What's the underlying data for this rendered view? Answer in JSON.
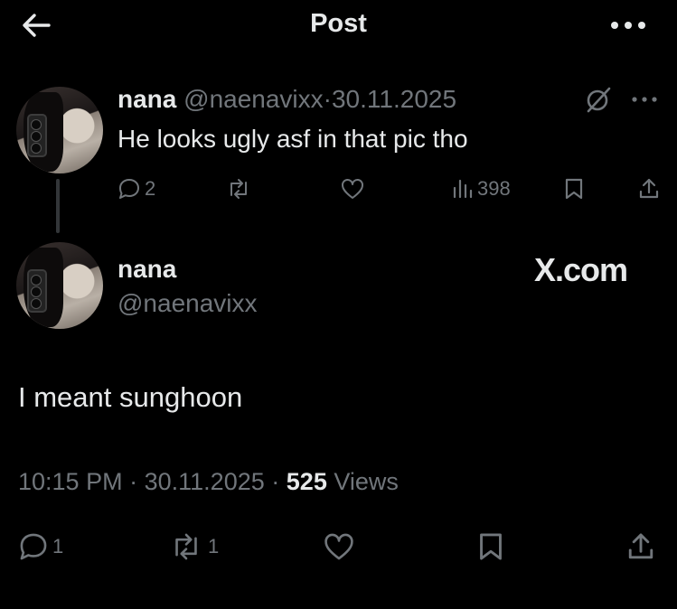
{
  "header": {
    "title": "Post",
    "back_icon": "arrow-left-icon",
    "more_icon": "more-horizontal-icon"
  },
  "reply_tweet": {
    "display_name": "nana",
    "handle": "@naenavixx",
    "separator": "·",
    "date": "30.11.2025",
    "text": "He looks ugly asf in that pic tho",
    "actions": {
      "replies": "2",
      "views": "398"
    }
  },
  "main_tweet": {
    "display_name": "nana",
    "handle": "@naenavixx",
    "watermark": "X.com",
    "text": "I meant sunghoon",
    "time": "10:15 PM",
    "sep1": "·",
    "date": "30.11.2025",
    "sep2": "·",
    "views_count": "525",
    "views_label": "Views",
    "actions": {
      "replies": "1",
      "reposts": "1"
    }
  },
  "colors": {
    "background": "#000000",
    "text": "#e7e9ea",
    "muted": "#71767b"
  }
}
